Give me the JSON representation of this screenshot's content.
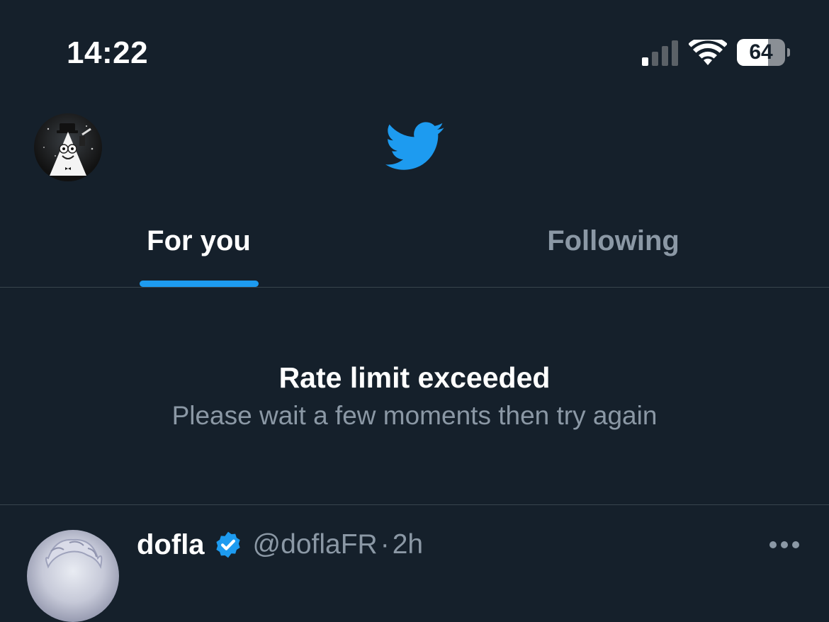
{
  "status_bar": {
    "time": "14:22",
    "signal_icon": "cellular-signal-icon",
    "signal_bars_active": 1,
    "signal_bars_total": 4,
    "wifi_icon": "wifi-icon",
    "battery_level": "64",
    "battery_fraction": 0.64
  },
  "header": {
    "avatar_icon": "profile-avatar",
    "logo_icon": "twitter-bird-icon"
  },
  "tabs": [
    {
      "label": "For you",
      "active": true
    },
    {
      "label": "Following",
      "active": false
    }
  ],
  "error": {
    "title": "Rate limit exceeded",
    "subtitle": "Please wait a few moments then try again"
  },
  "tweet": {
    "name": "dofla",
    "verified": true,
    "handle": "@doflaFR",
    "separator": "·",
    "time": "2h",
    "more_icon": "more-options-icon"
  },
  "colors": {
    "background": "#15202b",
    "accent": "#1d9bf0",
    "secondary_text": "#8b98a5",
    "divider": "#38444d"
  }
}
